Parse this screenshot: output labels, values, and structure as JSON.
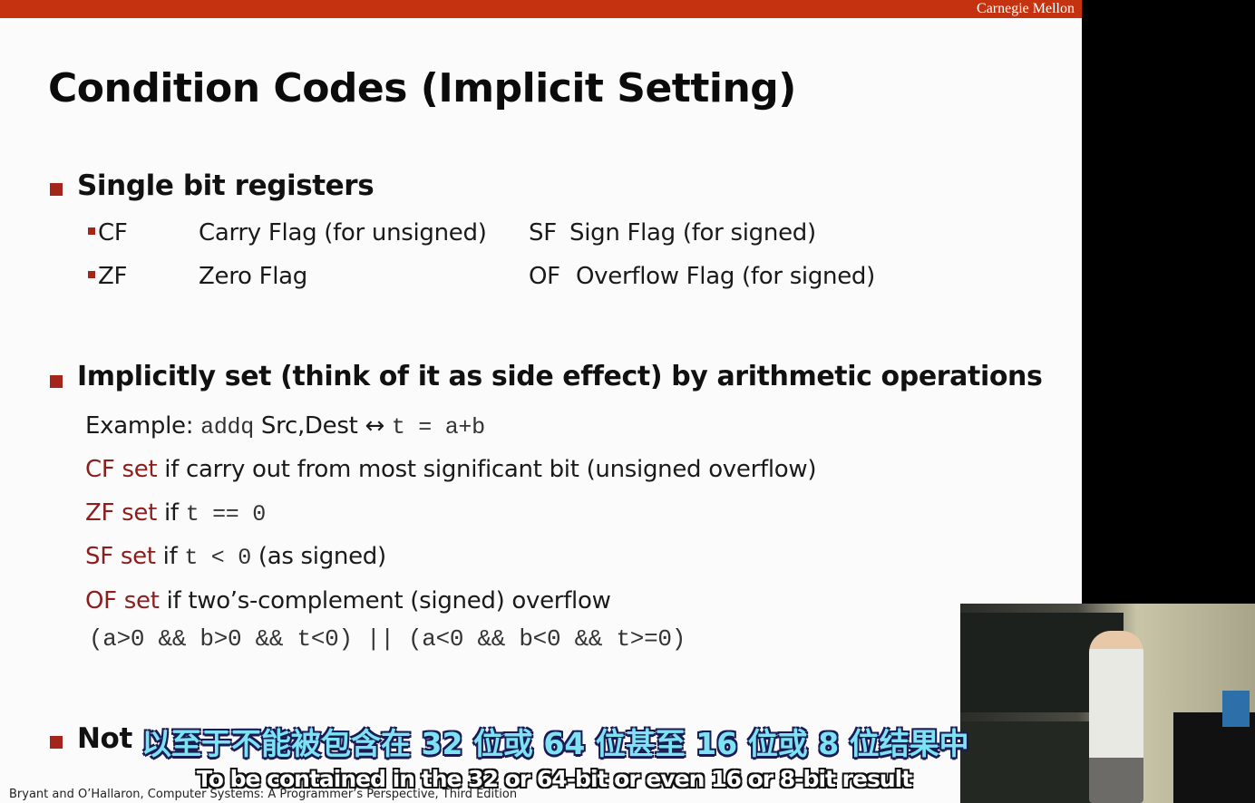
{
  "header": {
    "brand": "Carnegie Mellon"
  },
  "title": "Condition Codes (Implicit Setting)",
  "section1": {
    "heading": "Single bit registers",
    "rows": [
      {
        "code": "CF",
        "desc": "Carry Flag (for unsigned)",
        "code2": "SF",
        "desc2": "Sign Flag (for signed)"
      },
      {
        "code": "ZF",
        "desc": "Zero Flag",
        "code2": "OF",
        "desc2": "Overflow Flag (for signed)"
      }
    ]
  },
  "section2": {
    "heading": "Implicitly set (think of it as side effect) by arithmetic operations",
    "example_label": "Example:",
    "example_instr": "addq",
    "example_args": "Src,Dest",
    "example_arrow": "↔",
    "example_expr": "t = a+b",
    "cf_red": "CF set",
    "cf_rest": "if carry out from most significant bit (unsigned overflow)",
    "zf_red": "ZF set",
    "zf_if": "if",
    "zf_expr": "t == 0",
    "sf_red": "SF set",
    "sf_if": "if",
    "sf_expr": "t < 0",
    "sf_rest": "(as signed)",
    "of_red": "OF set",
    "of_rest": "if two’s-complement (signed) overflow",
    "of_expr": "(a>0 && b>0 && t<0) || (a<0 && b<0 && t>=0)"
  },
  "section3": {
    "heading_visible": "Not"
  },
  "footer": "Bryant and O’Hallaron, Computer Systems: A Programmer’s Perspective, Third Edition",
  "subtitles": {
    "chinese": "以至于不能被包含在 32 位或 64 位甚至 16 位或 8 位结果中",
    "english": "To be contained in the 32 or 64-bit or even 16 or 8-bit result"
  },
  "colors": {
    "accent_bar": "#c4320f",
    "bullet": "#a4251b",
    "flag_red": "#8b1e1e",
    "subtitle_cn": "#7de3f2"
  }
}
